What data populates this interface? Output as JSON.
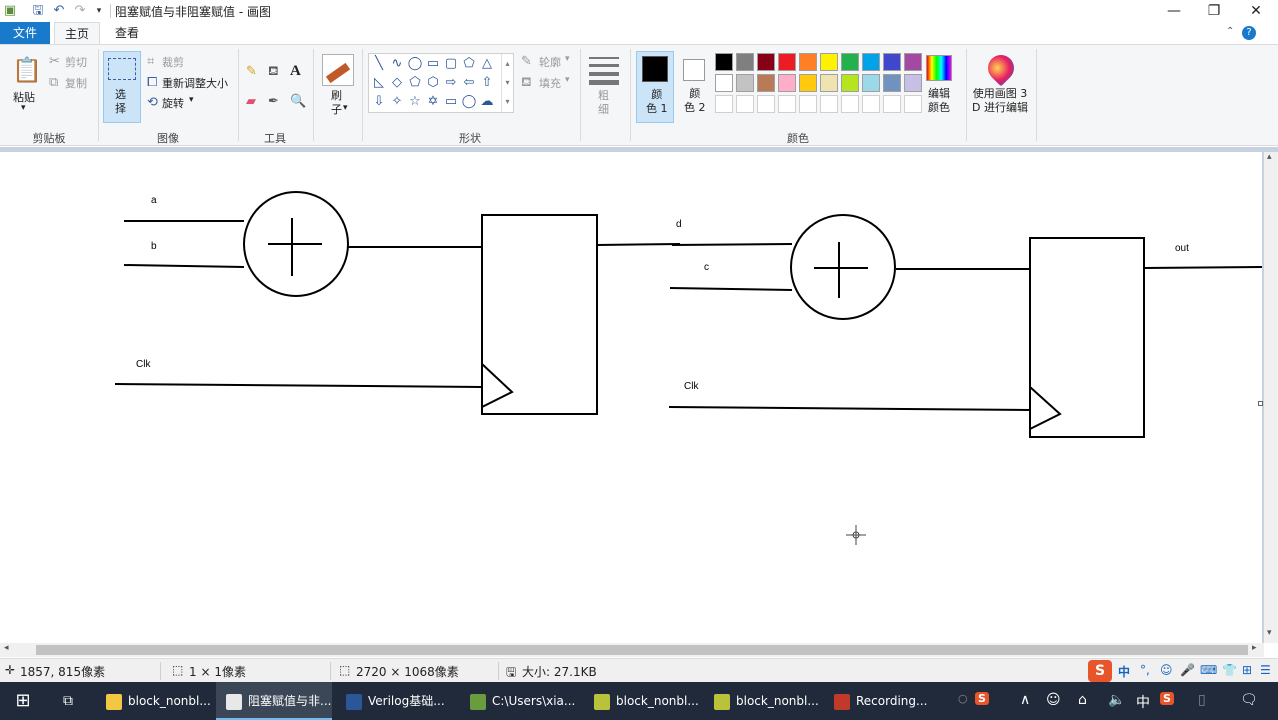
{
  "window": {
    "title": "阻塞赋值与非阻塞赋值 - 画图",
    "minimize": "—",
    "restore": "❐",
    "close": "✕"
  },
  "menu": {
    "file": "文件",
    "home": "主页",
    "view": "查看"
  },
  "ribbon": {
    "clipboard": {
      "paste": "粘贴",
      "cut": "剪切",
      "copy": "复制",
      "label": "剪贴板"
    },
    "image": {
      "select": "选\n择",
      "crop": "裁剪",
      "resize": "重新调整大小",
      "rotate": "旋转",
      "label": "图像"
    },
    "tools": {
      "label": "工具"
    },
    "brushes": {
      "label": "刷\n子"
    },
    "shapes": {
      "outline": "轮廓",
      "fill": "填充",
      "label": "形状"
    },
    "size": {
      "label": "粗\n细"
    },
    "colors": {
      "color1": "颜\n色 1",
      "color2": "颜\n色 2",
      "edit": "编辑\n颜色",
      "paint3d": "使用画图 3\nD 进行编辑",
      "label": "颜色",
      "palette_row1": [
        "#000000",
        "#7f7f7f",
        "#880015",
        "#ed1c24",
        "#ff7f27",
        "#fff200",
        "#22b14c",
        "#00a2e8",
        "#3f48cc",
        "#a349a4"
      ],
      "palette_row2": [
        "#ffffff",
        "#c3c3c3",
        "#b97a57",
        "#ffaec9",
        "#ffc90e",
        "#efe4b0",
        "#b5e61d",
        "#99d9ea",
        "#7092be",
        "#c8bfe7"
      ]
    }
  },
  "diagram": {
    "stage1": {
      "in_a": "a",
      "in_b": "b",
      "clk": "Clk"
    },
    "stage2": {
      "in_d": "d",
      "in_c": "c",
      "clk": "Clk",
      "out": "out"
    }
  },
  "status": {
    "cursor": "1857, 815像素",
    "selection": "1 × 1像素",
    "dimensions": "2720 × 1068像素",
    "filesize": "大小: 27.1KB"
  },
  "taskbar": {
    "tasks": [
      {
        "label": "block_nonbl...",
        "color": "#f2c744"
      },
      {
        "label": "阻塞赋值与非...",
        "color": "#e8e8e8"
      },
      {
        "label": "Verilog基础...",
        "color": "#2b579a"
      },
      {
        "label": "C:\\Users\\xia...",
        "color": "#6a9b3e"
      },
      {
        "label": "block_nonbl...",
        "color": "#b8c23a"
      },
      {
        "label": "block_nonbl...",
        "color": "#b8c23a"
      },
      {
        "label": "Recording...",
        "color": "#c0392b"
      }
    ]
  }
}
